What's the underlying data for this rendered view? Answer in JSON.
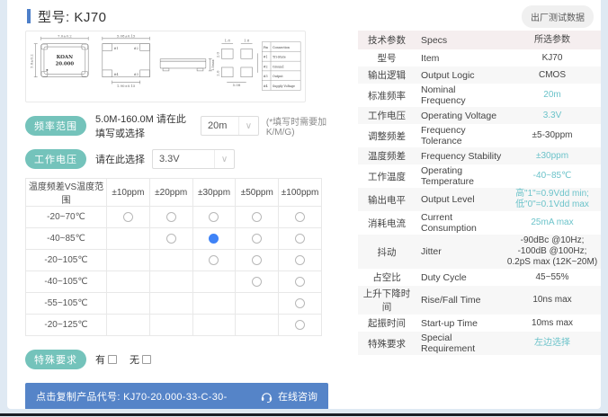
{
  "colors": {
    "accent_blue": "#4d7fc9",
    "badge_teal": "#74c3bb",
    "value_teal": "#6cc3ca",
    "bar_blue": "#5584c8",
    "radio_selected_blue": "#3f83f7"
  },
  "page": {
    "title": "型号: KJ70",
    "factory_test_button": "出厂测试数据"
  },
  "drawing": {
    "top_view": {
      "brand": "KOAN",
      "marking": "20.000",
      "dim_width": "7.0±0.2",
      "dim_height": "5.0±0.2"
    },
    "bottom_view": {
      "dim_width": "5.08±0.15",
      "dim_pad": "1.90±0.15",
      "pad_tl": "#1",
      "pad_tr": "#2",
      "pad_bl": "#4",
      "pad_br": "#3"
    },
    "side_view": {
      "dim_height": "1.5max"
    },
    "land_pattern": {
      "dim_pad_w1": "1.8",
      "dim_pad_w2": "1.8",
      "dim_pad_h1": "2.0",
      "dim_pad_h2": "2.0",
      "dim_span": "5.08"
    },
    "pin_table": {
      "headers": [
        "Pin",
        "Connection"
      ],
      "rows": [
        [
          "#1",
          "Tri-State"
        ],
        [
          "#2",
          "Ground"
        ],
        [
          "#3",
          "Output"
        ],
        [
          "#4",
          "Supply Voltage"
        ]
      ]
    }
  },
  "frequency_row": {
    "badge": "频率范围",
    "text": "5.0M-160.0M 请在此填写或选择",
    "dropdown_value": "20m",
    "note": "(*填写时需要加K/M/G)"
  },
  "voltage_row": {
    "badge": "工作电压",
    "text": "请在此选择",
    "dropdown_value": "3.3V"
  },
  "stability_table": {
    "header": [
      "温度频差VS温度范围",
      "±10ppm",
      "±20ppm",
      "±30ppm",
      "±50ppm",
      "±100ppm"
    ],
    "rows": [
      {
        "label": "-20~70℃",
        "cells": [
          "radio",
          "radio",
          "radio",
          "radio",
          "radio"
        ]
      },
      {
        "label": "-40~85℃",
        "cells": [
          "none",
          "radio",
          "selected",
          "radio",
          "radio"
        ]
      },
      {
        "label": "-20~105℃",
        "cells": [
          "none",
          "none",
          "radio",
          "radio",
          "radio"
        ]
      },
      {
        "label": "-40~105℃",
        "cells": [
          "none",
          "none",
          "none",
          "radio",
          "radio"
        ]
      },
      {
        "label": "-55~105℃",
        "cells": [
          "none",
          "none",
          "none",
          "none",
          "radio"
        ]
      },
      {
        "label": "-20~125℃",
        "cells": [
          "none",
          "none",
          "none",
          "none",
          "radio"
        ]
      }
    ]
  },
  "special_row": {
    "badge": "特殊要求",
    "yes_label": "有",
    "no_label": "无"
  },
  "bottom_bar": {
    "copy_text": "点击复制产品代号: KJ70-20.000-33-C-30-",
    "consult_label": "在线咨询"
  },
  "specs_table": {
    "headers": [
      "技术参数",
      "Specs",
      "所选参数"
    ],
    "rows": [
      {
        "cn": "型号",
        "en": "Item",
        "value": "KJ70",
        "highlight": false
      },
      {
        "cn": "输出逻辑",
        "en": "Output Logic",
        "value": "CMOS",
        "highlight": false
      },
      {
        "cn": "标准频率",
        "en": "Nominal Frequency",
        "value": "20m",
        "highlight": true
      },
      {
        "cn": "工作电压",
        "en": "Operating Voltage",
        "value": "3.3V",
        "highlight": true
      },
      {
        "cn": "调整频差",
        "en": "Frequency Tolerance",
        "value": "±5-30ppm",
        "highlight": false
      },
      {
        "cn": "温度频差",
        "en": "Frequency Stability",
        "value": "±30ppm",
        "highlight": true
      },
      {
        "cn": "工作温度",
        "en": "Operating Temperature",
        "value": "-40~85℃",
        "highlight": true
      },
      {
        "cn": "输出电平",
        "en": "Output Level",
        "value": "高\"1\"=0.9Vdd min;\n低\"0\"=0.1Vdd max",
        "highlight": true
      },
      {
        "cn": "消耗电流",
        "en": "Current Consumption",
        "value": "25mA max",
        "highlight": true
      },
      {
        "cn": "抖动",
        "en": "Jitter",
        "value": "-90dBc @10Hz;\n-100dB @100Hz;\n0.2pS max (12K~20M)",
        "highlight": false
      },
      {
        "cn": "占空比",
        "en": "Duty Cycle",
        "value": "45~55%",
        "highlight": false
      },
      {
        "cn": "上升下降时间",
        "en": "Rise/Fall Time",
        "value": "10ns max",
        "highlight": false
      },
      {
        "cn": "起振时间",
        "en": "Start-up Time",
        "value": "10ms max",
        "highlight": false
      },
      {
        "cn": "特殊要求",
        "en": "Special Requirement",
        "value": "左边选择",
        "highlight": true
      }
    ]
  }
}
